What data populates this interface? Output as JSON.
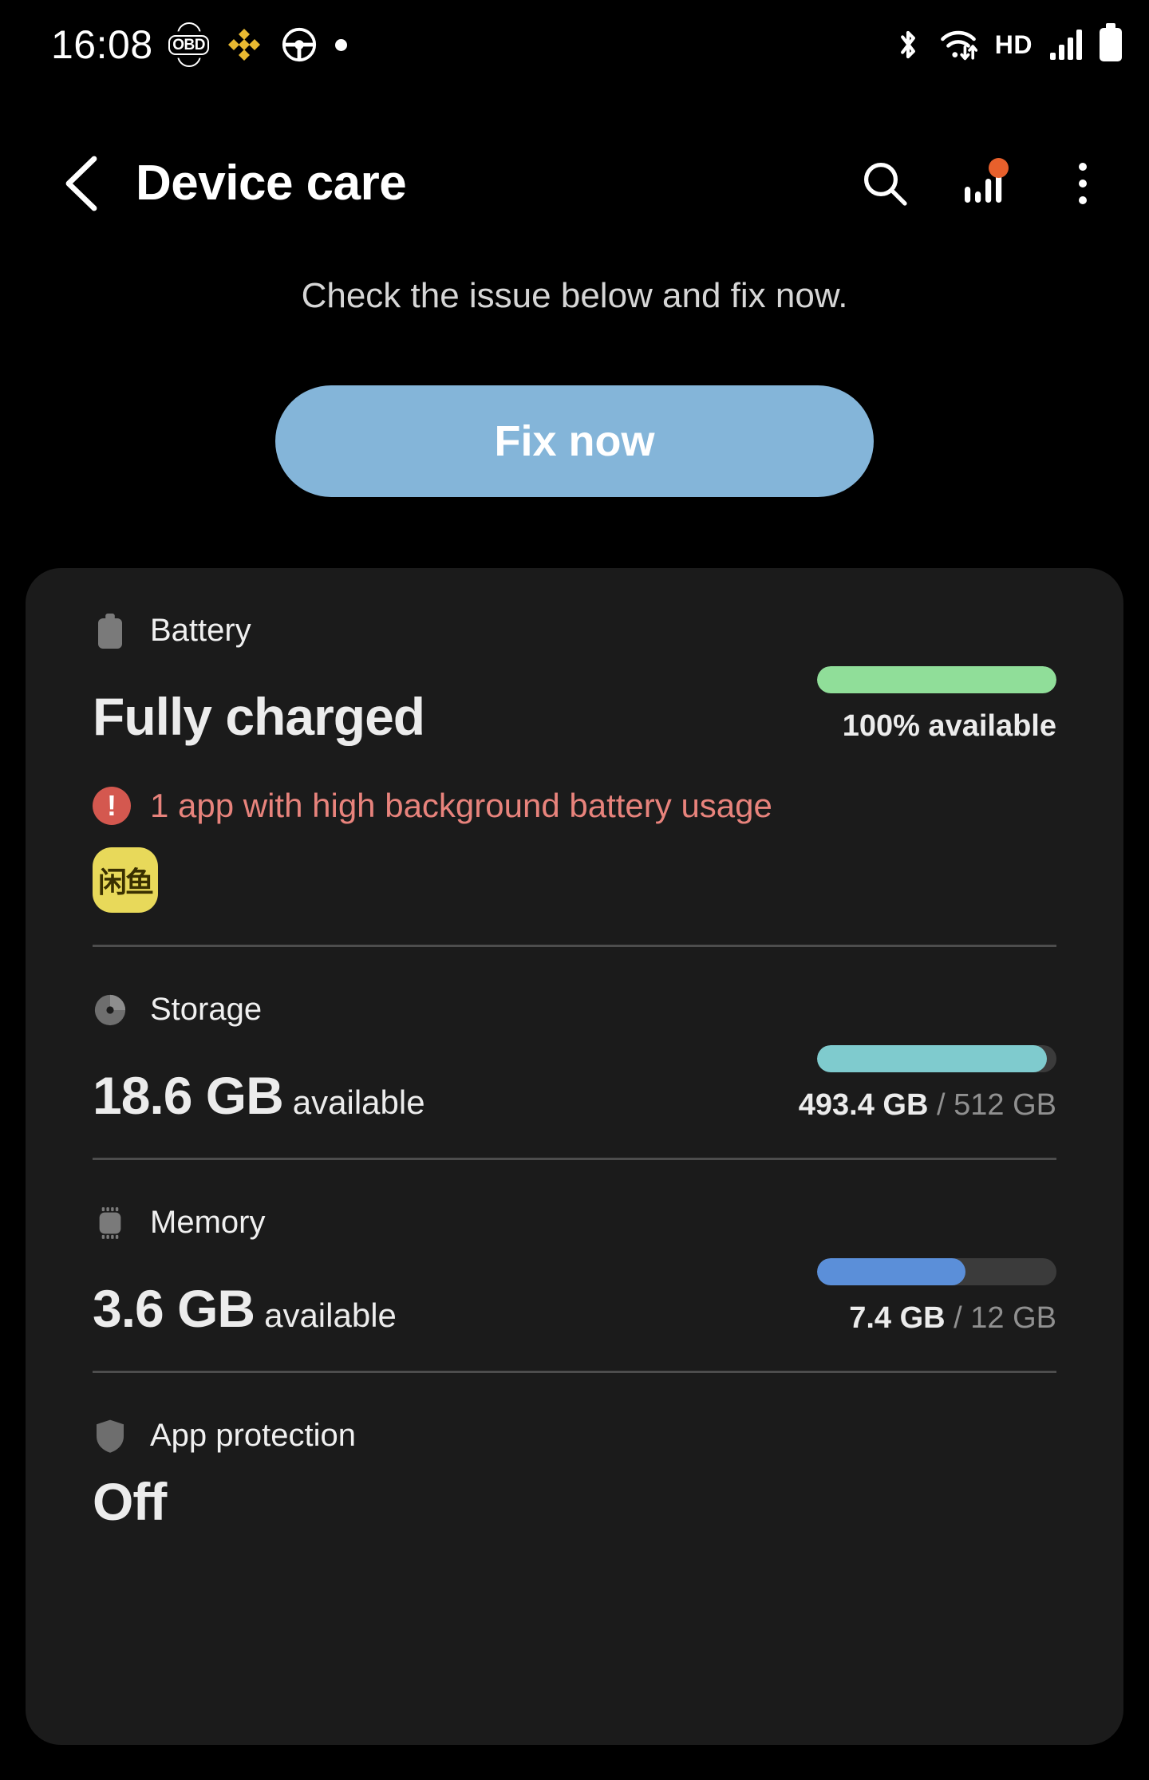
{
  "statusbar": {
    "time": "16:08",
    "left_icons": [
      "obd-icon",
      "binance-icon",
      "steering-wheel-icon",
      "dot-icon"
    ],
    "hd_label": "HD",
    "right_icons": [
      "bluetooth-icon",
      "wifi-icon",
      "signal-icon",
      "battery-icon"
    ]
  },
  "appbar": {
    "title": "Device care",
    "back_icon": "back-chevron-icon",
    "search_icon": "search-icon",
    "diagnostics_icon": "bar-chart-icon",
    "more_icon": "more-options-icon",
    "badge_color": "#E8602C"
  },
  "hint": {
    "text": "Check the issue below and fix now."
  },
  "fix_button": {
    "label": "Fix now",
    "color": "#84B5D9"
  },
  "sections": {
    "battery": {
      "label": "Battery",
      "icon": "battery-icon",
      "status": "Fully charged",
      "meter_text_value": "100% available",
      "bar_percent": 100,
      "bar_color": "#90DE99",
      "warning": {
        "text": "1 app with high background battery usage",
        "color": "#E8837C",
        "icon": "exclamation-circle-icon",
        "app_icon_label": "闲鱼",
        "app_icon_color": "#E8D95A"
      }
    },
    "storage": {
      "label": "Storage",
      "icon": "pie-chart-icon",
      "value": "18.6 GB",
      "value_suffix": "available",
      "used": "493.4 GB",
      "separator": " / ",
      "total": "512 GB",
      "bar_percent": 96,
      "bar_color": "#7FCBCE"
    },
    "memory": {
      "label": "Memory",
      "icon": "memory-chip-icon",
      "value": "3.6 GB",
      "value_suffix": "available",
      "used": "7.4 GB",
      "separator": " / ",
      "total": "12 GB",
      "bar_percent": 62,
      "bar_color": "#5B8FD9"
    },
    "app_protection": {
      "label": "App protection",
      "icon": "shield-icon",
      "status": "Off"
    }
  }
}
